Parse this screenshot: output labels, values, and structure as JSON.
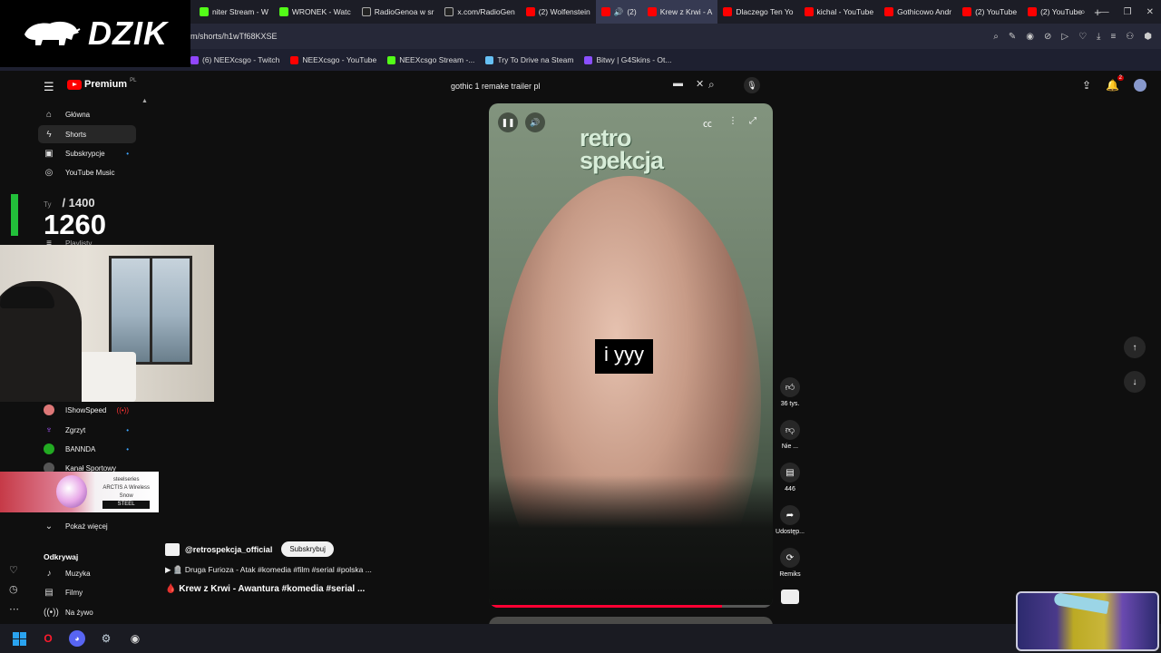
{
  "browser": {
    "tabs": [
      {
        "label": "niter Stream - W",
        "color": "#53fc18"
      },
      {
        "label": "WRONEK - Watc",
        "color": "#53fc18"
      },
      {
        "label": "RadioGenoa w sr",
        "color": "#ffffff"
      },
      {
        "label": "x.com/RadioGen",
        "color": "#ffffff"
      },
      {
        "label": "(2) Wolfenstein",
        "color": "#ff0000"
      },
      {
        "label": "(2)",
        "color": "#ff0000"
      },
      {
        "label": "Krew z Krwi - A",
        "color": "#ff0000"
      },
      {
        "label": "Dlaczego Ten Yo",
        "color": "#ff0000"
      },
      {
        "label": "kichal - YouTube",
        "color": "#ff0000"
      },
      {
        "label": "Gothicowo Andr",
        "color": "#ff0000"
      },
      {
        "label": "(2) YouTube",
        "color": "#ff0000"
      },
      {
        "label": "(2) YouTube",
        "color": "#ff0000"
      }
    ],
    "url": "m/shorts/h1wTf68KXSE",
    "bookmarks": [
      {
        "label": "(6) NEEXcsgo - Twitch",
        "color": "#9146ff"
      },
      {
        "label": "NEEXcsgo - YouTube",
        "color": "#ff0000"
      },
      {
        "label": "NEEXcsgo Stream -...",
        "color": "#53fc18"
      },
      {
        "label": "Try To Drive na Steam",
        "color": "#66c0f4"
      },
      {
        "label": "Bitwy | G4Skins - Ot...",
        "color": "#8a4fff"
      }
    ]
  },
  "logo": {
    "text": "DZIK"
  },
  "youtube": {
    "brand": "Premium",
    "brand_region": "PL",
    "search_value": "gothic 1 remake trailer pl",
    "notif_count": "2",
    "sidebar": {
      "items": [
        {
          "label": "Główna",
          "icon": "home-icon"
        },
        {
          "label": "Shorts",
          "icon": "shorts-icon"
        },
        {
          "label": "Subskrypcje",
          "icon": "subscriptions-icon"
        },
        {
          "label": "YouTube Music",
          "icon": "music-icon"
        }
      ],
      "hidden_item": "Playlisty",
      "channels": [
        {
          "label": "IShowSpeed"
        },
        {
          "label": "Zgrzyt"
        },
        {
          "label": "BANNDA"
        },
        {
          "label": "Kanał Sportowy"
        }
      ],
      "show_more": "Pokaż więcej",
      "explore_heading": "Odkrywaj",
      "explore": [
        {
          "label": "Muzyka"
        },
        {
          "label": "Filmy"
        },
        {
          "label": "Na żywo"
        }
      ]
    },
    "video": {
      "overlay_logo_line1": "retro",
      "overlay_logo_line2": "spekcja",
      "subtitle": "i yyy",
      "progress": 0.82
    },
    "channel": {
      "handle": "@retrospekcja_official",
      "subscribe_label": "Subskrybuj"
    },
    "description": "🪦 Druga Furioza - Atak #komedia #film #serial #polska ...",
    "title": "🩸 Krew z Krwi - Awantura #komedia #serial ...",
    "actions": {
      "likes": "36 tys.",
      "dislike": "Nie ...",
      "comments": "446",
      "share": "Udostęp...",
      "remix": "Remiks"
    }
  },
  "overlay": {
    "counter_label": "Ty",
    "counter_total": "/ 1400",
    "counter_value": "1260",
    "ad_text_line1": "steelseries",
    "ad_text_line2": "ARCTIS A Wireless",
    "ad_text_line3": "Snow",
    "ad_text_line4": "STEEL"
  }
}
